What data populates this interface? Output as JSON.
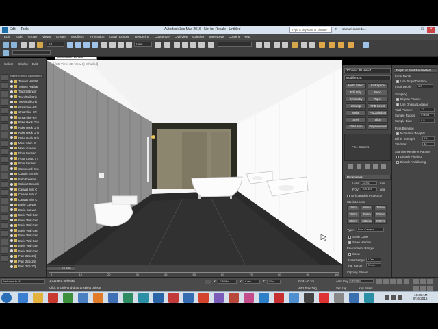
{
  "titlebar": {
    "tab_label": "Workspace: Default",
    "menu_labels": [
      "Edit",
      "Tools",
      "Group",
      "Views",
      "Create",
      "Modifiers",
      "Animation",
      "Graph Editors",
      "Rendering",
      "Customize",
      "Civil View",
      "Scripting",
      "Interactive",
      "Content",
      "Help"
    ],
    "title": "Autodesk 3ds Max 2016 - Not for Resale - Untitled",
    "search_placeholder": "Type a keyword or phrase",
    "user": "samuel.macedo..."
  },
  "menubar": {
    "items": [
      "Edit",
      "Tools",
      "Group",
      "Views",
      "Create",
      "Modifiers",
      "Animation",
      "Graph Editors",
      "Rendering",
      "Customize",
      "Civil View",
      "Scripting",
      "Interactive",
      "Content",
      "Help"
    ]
  },
  "toolbar": {
    "filter_select": "All",
    "view_select": "View",
    "named_selection": ""
  },
  "scene_explorer": {
    "tabs": [
      "Select",
      "Display",
      "Edit"
    ],
    "header": "Name (Sorted Ascending)",
    "rows": [
      "Tuinder Habitat",
      "Tuinder Habitat",
      "TrackSildingor",
      "TowelRail Grip",
      "TowelRail Grip",
      "streamline-KN",
      "streamline-KN",
      "streamline-KN",
      "Robe Hook Grip",
      "Robe Hook Grip",
      "Robe Hook Grip",
      "Robe Hook Grip",
      "Mixer Main Gr",
      "Mixer Generic",
      "Floor Generic",
      "Floor CONCT T",
      "Floor Generic",
      "Compound Gen",
      "Curtain Generic",
      "Bath Freestan",
      "Cabinet Generic",
      "Canvas Mini C",
      "Canvas Mini C",
      "Canvas Mini C",
      "Basin Canvas",
      "Basin Canvas",
      "Basic Wall Gen",
      "Basic Wall Gen",
      "Basic Wall Gen",
      "Basic Wall Gen",
      "Basic Wall Gen",
      "Basic Wall Gen",
      "Basic Wall Gen",
      "Basic Wall Gen",
      "Part [224426]",
      "Part [224426]",
      "Part [224437]"
    ]
  },
  "viewport": {
    "label": "[+] [3D View: 3D View 1] [Shaded]"
  },
  "trackbar": {
    "frame_label": "0 / 100",
    "ticks": [
      "0",
      "10",
      "20",
      "30",
      "40",
      "50",
      "60",
      "70",
      "80",
      "90",
      "100"
    ]
  },
  "command_panel": {
    "object_name": "3D View: 3D View 1",
    "modifier_list": "Modifier List",
    "buttons": [
      "Mesh Select",
      "Edit Spline",
      "Edit Poly",
      "Bend",
      "Symmetry",
      "Taper",
      "Unwrap",
      "FFD Select",
      "Noise",
      "ProOptimizer",
      "Shell",
      "Slice",
      "UVW Map",
      "Displacement"
    ],
    "stack_item": "Free Camera",
    "parameters_title": "Parameters",
    "lens_label": "Lens:",
    "lens_value": "12.957",
    "fov_label": "FOV:",
    "fov_value": "108.353",
    "fov_unit": "deg",
    "ortho_label": "Orthographic Projection",
    "stock_lenses_label": "Stock Lenses",
    "stock_lenses": [
      "15mm",
      "20mm",
      "24mm",
      "28mm",
      "35mm",
      "50mm",
      "85mm",
      "135mm",
      "200mm"
    ],
    "type_label": "Type:",
    "type_value": "Free Camera",
    "show_cone": "Show Cone",
    "show_horizon": "Show Horizon",
    "env_ranges": "Environment Ranges",
    "env_show": "Show",
    "near_range_label": "Near Range:",
    "near_range_value": "0.0m",
    "far_range_label": "Far Range:",
    "far_range_value": "23.0m",
    "clipping_planes": "Clipping Planes"
  },
  "dof_panel": {
    "title": "Depth of Field Parameters",
    "focal_depth_label": "Focal Depth",
    "use_target_distance": "Use Target Distance",
    "focal_depth_field_label": "Focal Depth:",
    "focal_depth_value": "0.0",
    "sampling_label": "Sampling",
    "display_passes": "Display Passes",
    "use_original_location": "Use Original Location",
    "total_passes_label": "Total Passes:",
    "total_passes_value": "12",
    "sample_radius_label": "Sample Radius:",
    "sample_radius_value": "0.0005",
    "sample_bias_label": "Sample Bias:",
    "sample_bias_value": "0.5",
    "pass_blending_label": "Pass Blending",
    "normalize_weights": "Normalize Weights",
    "dither_strength_label": "Dither Strength:",
    "dither_strength_value": "0.4",
    "tile_size_label": "Tile Size:",
    "tile_size_value": "32",
    "scanline_label": "Scanline Renderer Params",
    "disable_filtering": "Disable Filtering",
    "disable_antialiasing": "Disable Antialiasing"
  },
  "statusbar": {
    "selection": "1 Camera Selected",
    "prompt": "Click or click-and-drag to select objects",
    "welcome": "Welcome to M",
    "x_label": "X:",
    "x_value": "-2.508m",
    "y_label": "Y:",
    "y_value": "0.0m",
    "z_label": "Z:",
    "z_value": "1.5m",
    "grid": "Grid = 0.1m",
    "add_time_tag": "Add Time Tag",
    "auto_key": "Auto Key",
    "set_key": "Set Key",
    "selected": "Selected",
    "key_filters": "Key Filters..."
  },
  "taskbar": {
    "time": "10:30 AM",
    "date": "6/16/2016"
  }
}
